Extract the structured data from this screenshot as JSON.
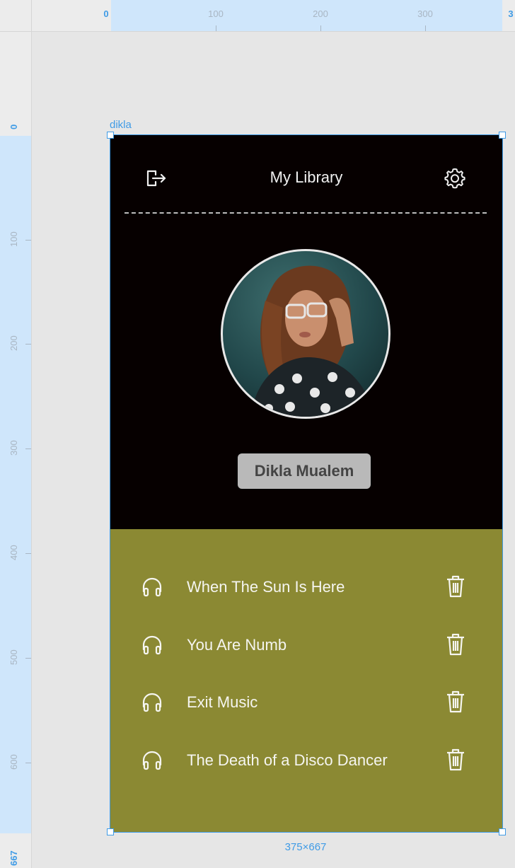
{
  "rulers": {
    "top": [
      "0",
      "100",
      "200",
      "300",
      "3"
    ],
    "left": [
      "0",
      "100",
      "200",
      "300",
      "400",
      "500",
      "600",
      "667"
    ]
  },
  "frame": {
    "name": "dikla",
    "size_label": "375×667"
  },
  "header": {
    "title": "My Library",
    "left_icon": "logout-icon",
    "right_icon": "gear-icon"
  },
  "profile": {
    "name": "Dikla Mualem"
  },
  "tracks": [
    {
      "title": "When The Sun Is Here"
    },
    {
      "title": "You Are Numb"
    },
    {
      "title": "Exit Music"
    },
    {
      "title": "The Death of a Disco Dancer"
    }
  ],
  "colors": {
    "top_background": "#060000",
    "bottom_background": "#8b8933",
    "selection": "#3f9be6"
  }
}
